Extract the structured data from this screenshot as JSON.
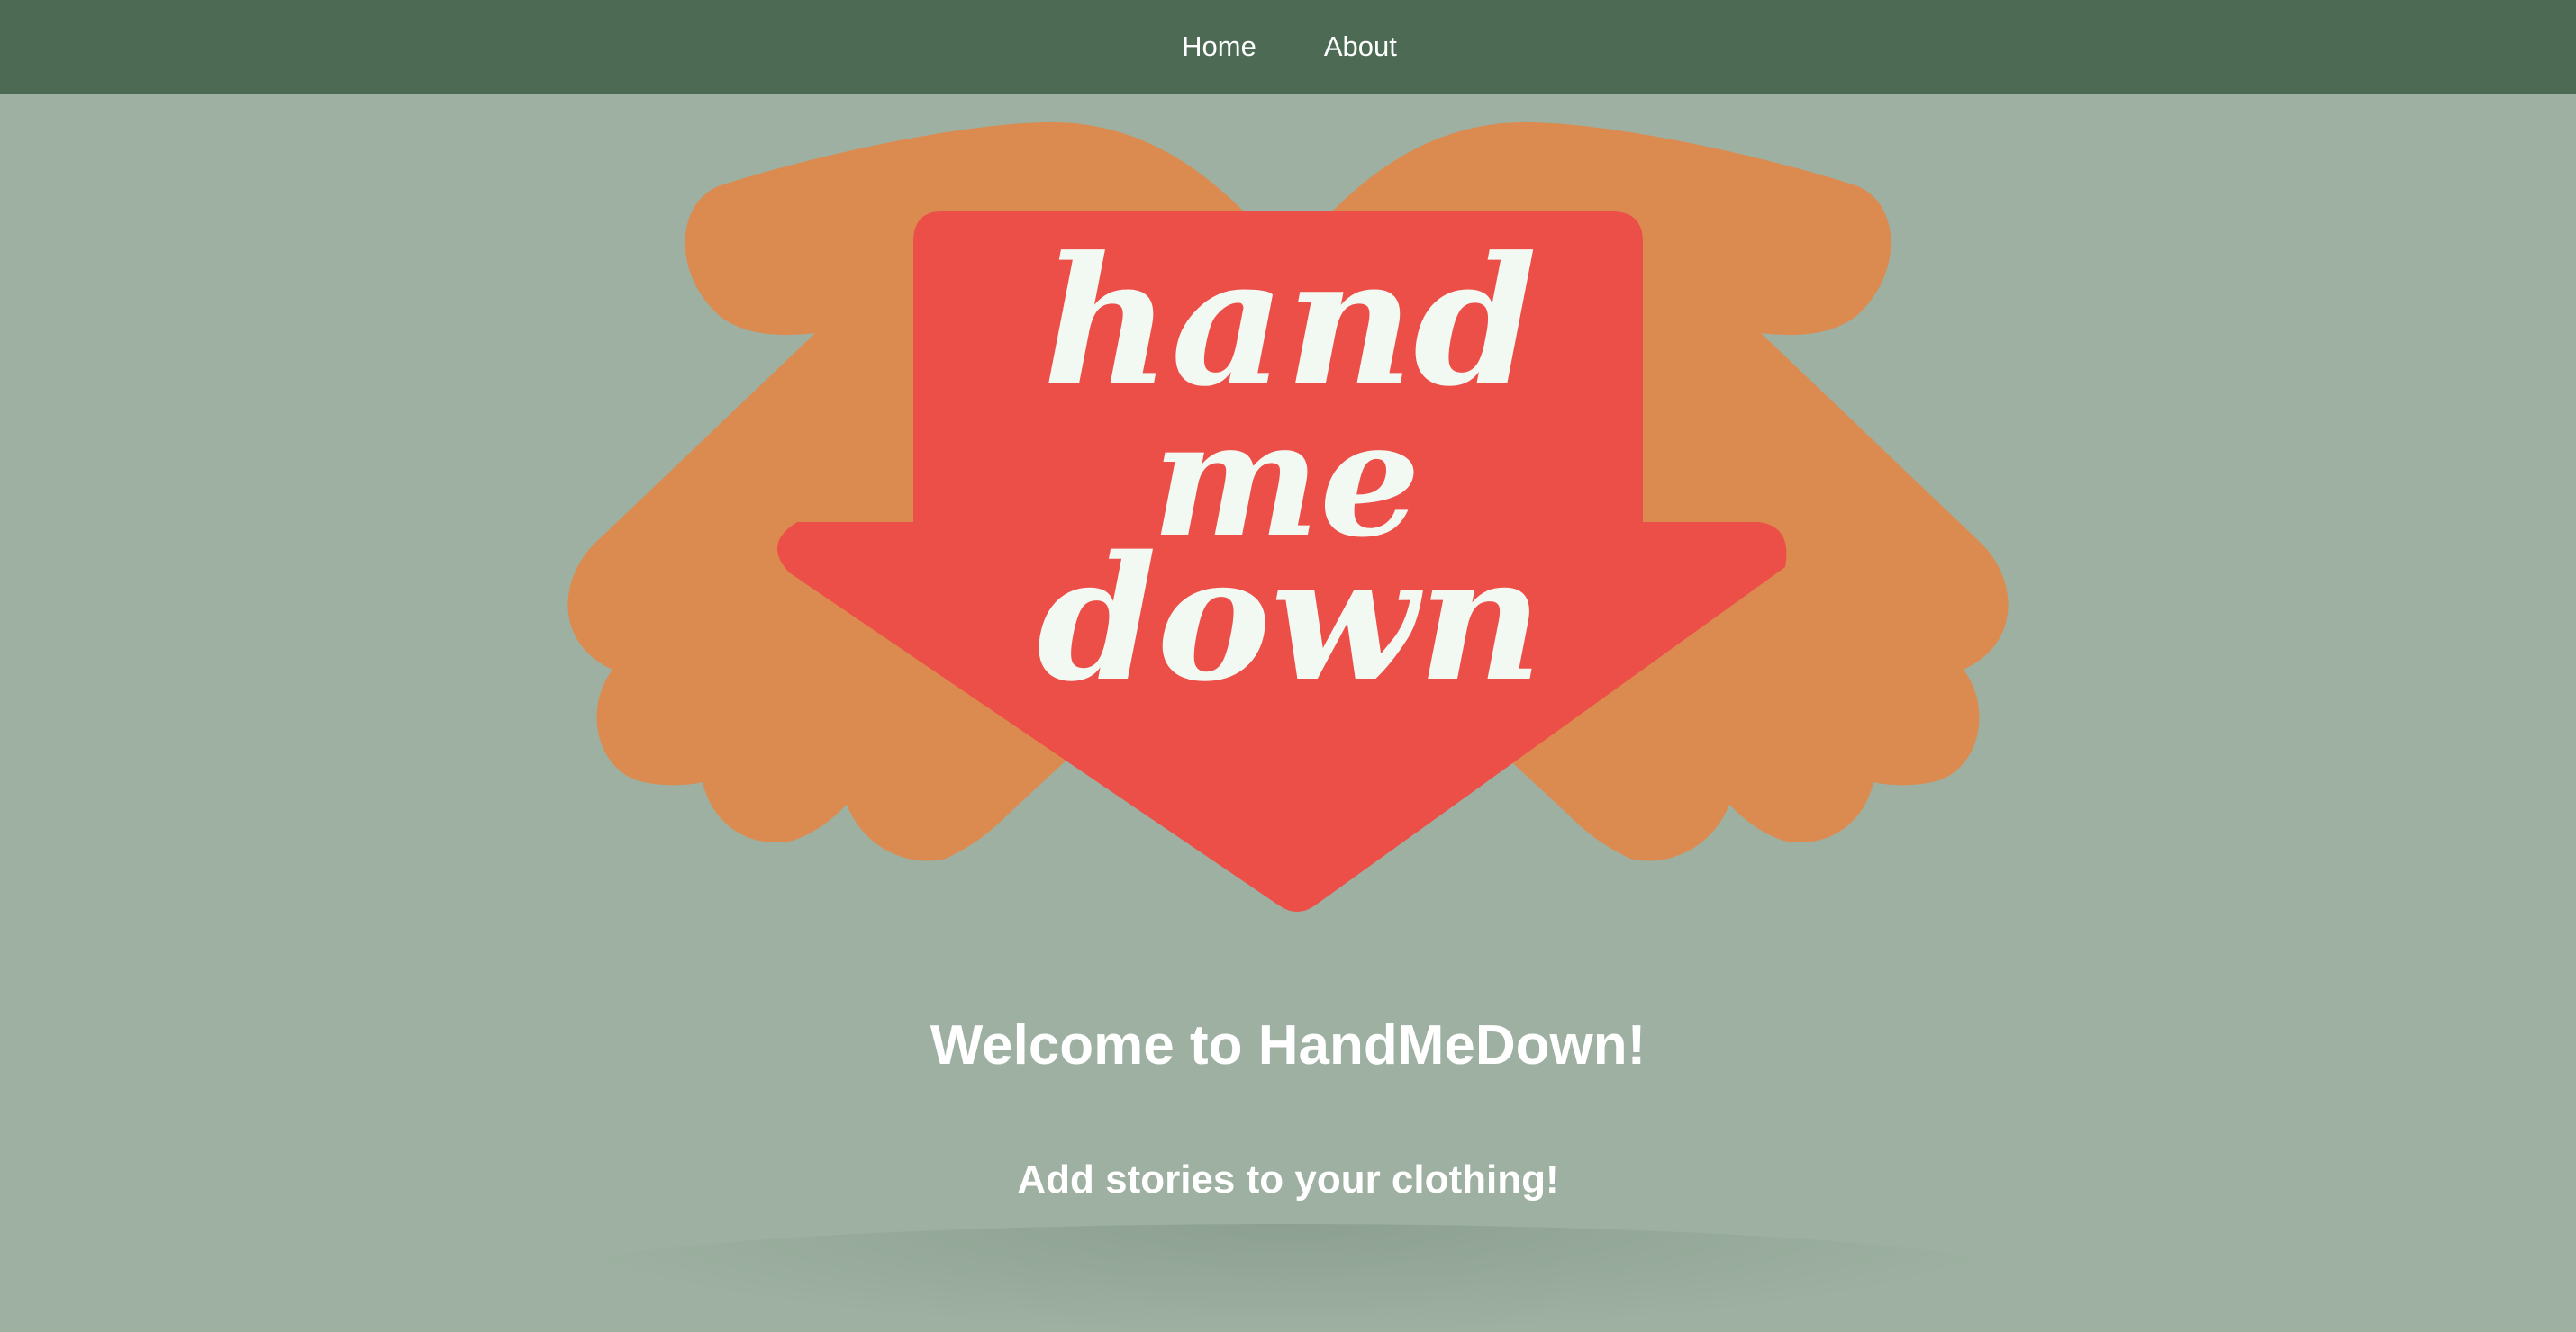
{
  "nav": {
    "items": [
      {
        "label": "Home"
      },
      {
        "label": "About"
      }
    ]
  },
  "logo": {
    "text_lines": [
      "hand",
      "me",
      "down"
    ],
    "colors": {
      "hands": "#dc8b50",
      "arrow": "#ec4e48",
      "lettering": "#f2f8f2"
    }
  },
  "hero": {
    "title": "Welcome to HandMeDown!",
    "subtitle": "Add stories to your clothing!"
  },
  "colors": {
    "background": "#9db0a1",
    "navbar": "#4d6b54",
    "text": "#ffffff"
  }
}
